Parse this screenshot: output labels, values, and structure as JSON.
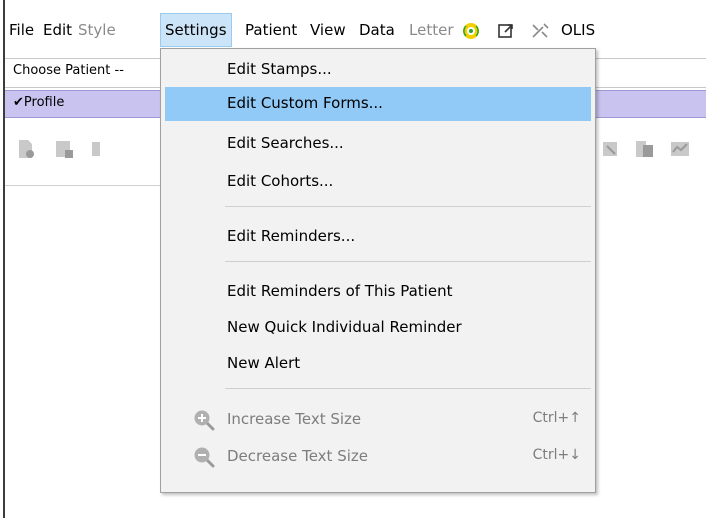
{
  "menubar": {
    "items": [
      {
        "label": "File",
        "state": "normal"
      },
      {
        "label": "Edit",
        "state": "normal"
      },
      {
        "label": "Style",
        "state": "disabled"
      },
      {
        "label": "Settings",
        "state": "active"
      },
      {
        "label": "Patient",
        "state": "normal"
      },
      {
        "label": "View",
        "state": "normal"
      },
      {
        "label": "Data",
        "state": "normal"
      },
      {
        "label": "Letter",
        "state": "disabled"
      },
      {
        "label": "OLIS",
        "state": "normal"
      }
    ],
    "icons": [
      "signal-icon",
      "external-link-icon",
      "satellite-icon"
    ]
  },
  "patient_bar": {
    "label": "Choose Patient --"
  },
  "profile_bar": {
    "label": "Profile"
  },
  "settings_menu": {
    "items": [
      {
        "label": "Edit Stamps...",
        "state": "normal"
      },
      {
        "label": "Edit Custom Forms...",
        "state": "hover"
      },
      {
        "label": "Edit Searches...",
        "state": "normal"
      },
      {
        "label": "Edit Cohorts...",
        "state": "normal"
      },
      {
        "label": "Edit Reminders...",
        "state": "normal"
      },
      {
        "label": "Edit Reminders of This Patient",
        "state": "normal"
      },
      {
        "label": "New Quick Individual Reminder",
        "state": "normal"
      },
      {
        "label": "New Alert",
        "state": "normal"
      },
      {
        "label": "Increase Text Size",
        "shortcut": "Ctrl+↑",
        "state": "disabled",
        "icon": "zoom-in-icon"
      },
      {
        "label": "Decrease Text Size",
        "shortcut": "Ctrl+↓",
        "state": "disabled",
        "icon": "zoom-out-icon"
      }
    ]
  },
  "colors": {
    "highlight": "#91c9f7",
    "menu_bg": "#f2f2f2",
    "profile_bar": "#c8c3ef",
    "active_menu": "#cce4f7"
  }
}
